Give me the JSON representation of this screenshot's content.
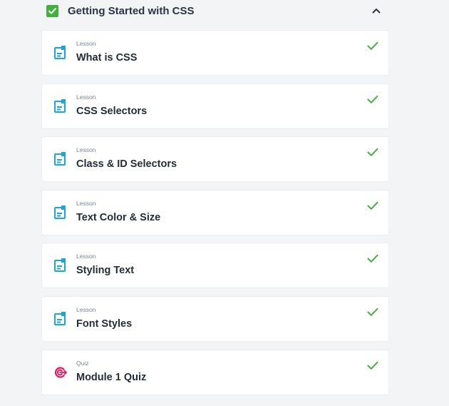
{
  "module": {
    "title": "Getting Started with CSS",
    "completed": true,
    "expanded": true,
    "collapse_icon": "chevron-up-icon"
  },
  "items": [
    {
      "type": "Lesson",
      "title": "What is CSS",
      "icon": "lesson-document-icon",
      "completed": true
    },
    {
      "type": "Lesson",
      "title": "CSS Selectors",
      "icon": "lesson-document-icon",
      "completed": true
    },
    {
      "type": "Lesson",
      "title": "Class & ID Selectors",
      "icon": "lesson-document-icon",
      "completed": true
    },
    {
      "type": "Lesson",
      "title": "Text Color & Size",
      "icon": "lesson-document-icon",
      "completed": true
    },
    {
      "type": "Lesson",
      "title": "Styling Text",
      "icon": "lesson-document-icon",
      "completed": true
    },
    {
      "type": "Lesson",
      "title": "Font Styles",
      "icon": "lesson-document-icon",
      "completed": true
    },
    {
      "type": "Quiz",
      "title": "Module 1 Quiz",
      "icon": "quiz-target-icon",
      "completed": true
    }
  ],
  "colors": {
    "complete_green": "#41b13e",
    "lesson_icon_blue": "#1aa5dd",
    "quiz_icon_pink": "#e8175d",
    "background": "#f3f4f6"
  }
}
